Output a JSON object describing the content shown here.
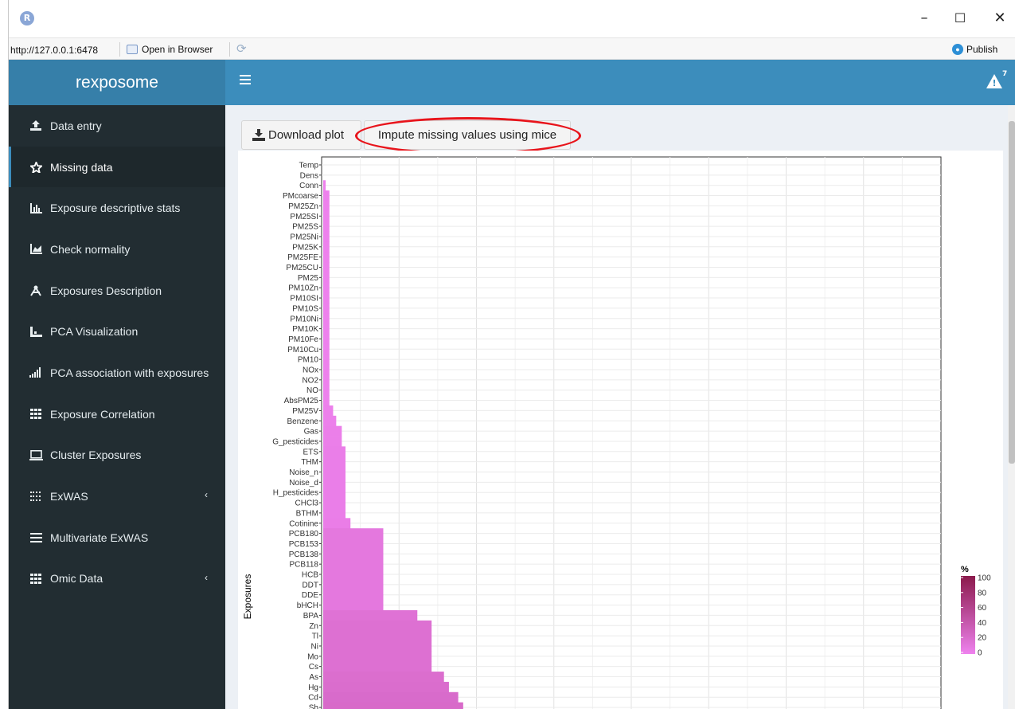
{
  "window": {
    "app_icon": "R",
    "minimize": "–",
    "maximize": "☐",
    "close": "✕"
  },
  "addressbar": {
    "url": "http://127.0.0.1:6478",
    "open_in_browser": "Open in Browser",
    "publish": "Publish"
  },
  "header": {
    "brand": "rexposome",
    "notification_count": "7"
  },
  "sidebar": {
    "items": [
      {
        "label": "Data entry",
        "icon": "upload-icon"
      },
      {
        "label": "Missing data",
        "icon": "star-icon"
      },
      {
        "label": "Exposure descriptive stats",
        "icon": "bar-chart-icon"
      },
      {
        "label": "Check normality",
        "icon": "area-chart-icon"
      },
      {
        "label": "Exposures Description",
        "icon": "compass-icon"
      },
      {
        "label": "PCA Visualization",
        "icon": "scatter-chart-icon"
      },
      {
        "label": "PCA association with exposures",
        "icon": "signal-icon"
      },
      {
        "label": "Exposure Correlation",
        "icon": "grid-icon"
      },
      {
        "label": "Cluster Exposures",
        "icon": "laptop-icon"
      },
      {
        "label": "ExWAS",
        "icon": "dotted-grid-icon",
        "chevron": "‹"
      },
      {
        "label": "Multivariate ExWAS",
        "icon": "list-icon"
      },
      {
        "label": "Omic Data",
        "icon": "grid-icon",
        "chevron": "‹"
      }
    ]
  },
  "toolbar": {
    "download_label": "Download plot",
    "impute_label": "Impute missing values using mice"
  },
  "colors": {
    "header": "#3c8dbc",
    "brand_bg": "#367fa9",
    "sidebar": "#222d32",
    "highlight": "#e8141b",
    "bar_low": "#ee82ee",
    "bar_high": "#8b1a4c"
  },
  "chart_data": {
    "type": "bar",
    "orientation": "horizontal",
    "ylabel": "Exposures",
    "legend": {
      "title": "%",
      "ticks": [
        "100",
        "80",
        "60",
        "40",
        "20",
        "0"
      ],
      "placement": "right"
    },
    "grid": true,
    "categories": [
      "Temp",
      "Dens",
      "Conn",
      "PMcoarse",
      "PM25Zn",
      "PM25SI",
      "PM25S",
      "PM25Ni",
      "PM25K",
      "PM25FE",
      "PM25CU",
      "PM25",
      "PM10Zn",
      "PM10SI",
      "PM10S",
      "PM10Ni",
      "PM10K",
      "PM10Fe",
      "PM10Cu",
      "PM10",
      "NOx",
      "NO2",
      "NO",
      "AbsPM25",
      "PM25V",
      "Benzene",
      "Gas",
      "G_pesticides",
      "ETS",
      "THM",
      "Noise_n",
      "Noise_d",
      "H_pesticides",
      "CHCl3",
      "BTHM",
      "Cotinine",
      "PCB180",
      "PCB153",
      "PCB138",
      "PCB118",
      "HCB",
      "DDT",
      "DDE",
      "bHCH",
      "BPA",
      "Zn",
      "Tl",
      "Ni",
      "Mo",
      "Cs",
      "As",
      "Hg",
      "Cd",
      "Sb"
    ],
    "values": [
      0,
      0,
      0.4,
      1.0,
      1.0,
      1.0,
      1.0,
      1.0,
      1.0,
      1.0,
      1.0,
      1.0,
      1.0,
      1.0,
      1.0,
      1.0,
      1.0,
      1.0,
      1.0,
      1.0,
      1.0,
      1.0,
      1.0,
      1.0,
      1.6,
      2.1,
      3.0,
      3.0,
      3.6,
      3.6,
      3.6,
      3.6,
      3.6,
      3.6,
      3.6,
      4.4,
      9.7,
      9.7,
      9.7,
      9.7,
      9.7,
      9.7,
      9.7,
      9.7,
      15.2,
      17.5,
      17.5,
      17.5,
      17.5,
      17.5,
      19.5,
      20.3,
      21.8,
      22.6
    ],
    "xlim": [
      0,
      100
    ]
  }
}
